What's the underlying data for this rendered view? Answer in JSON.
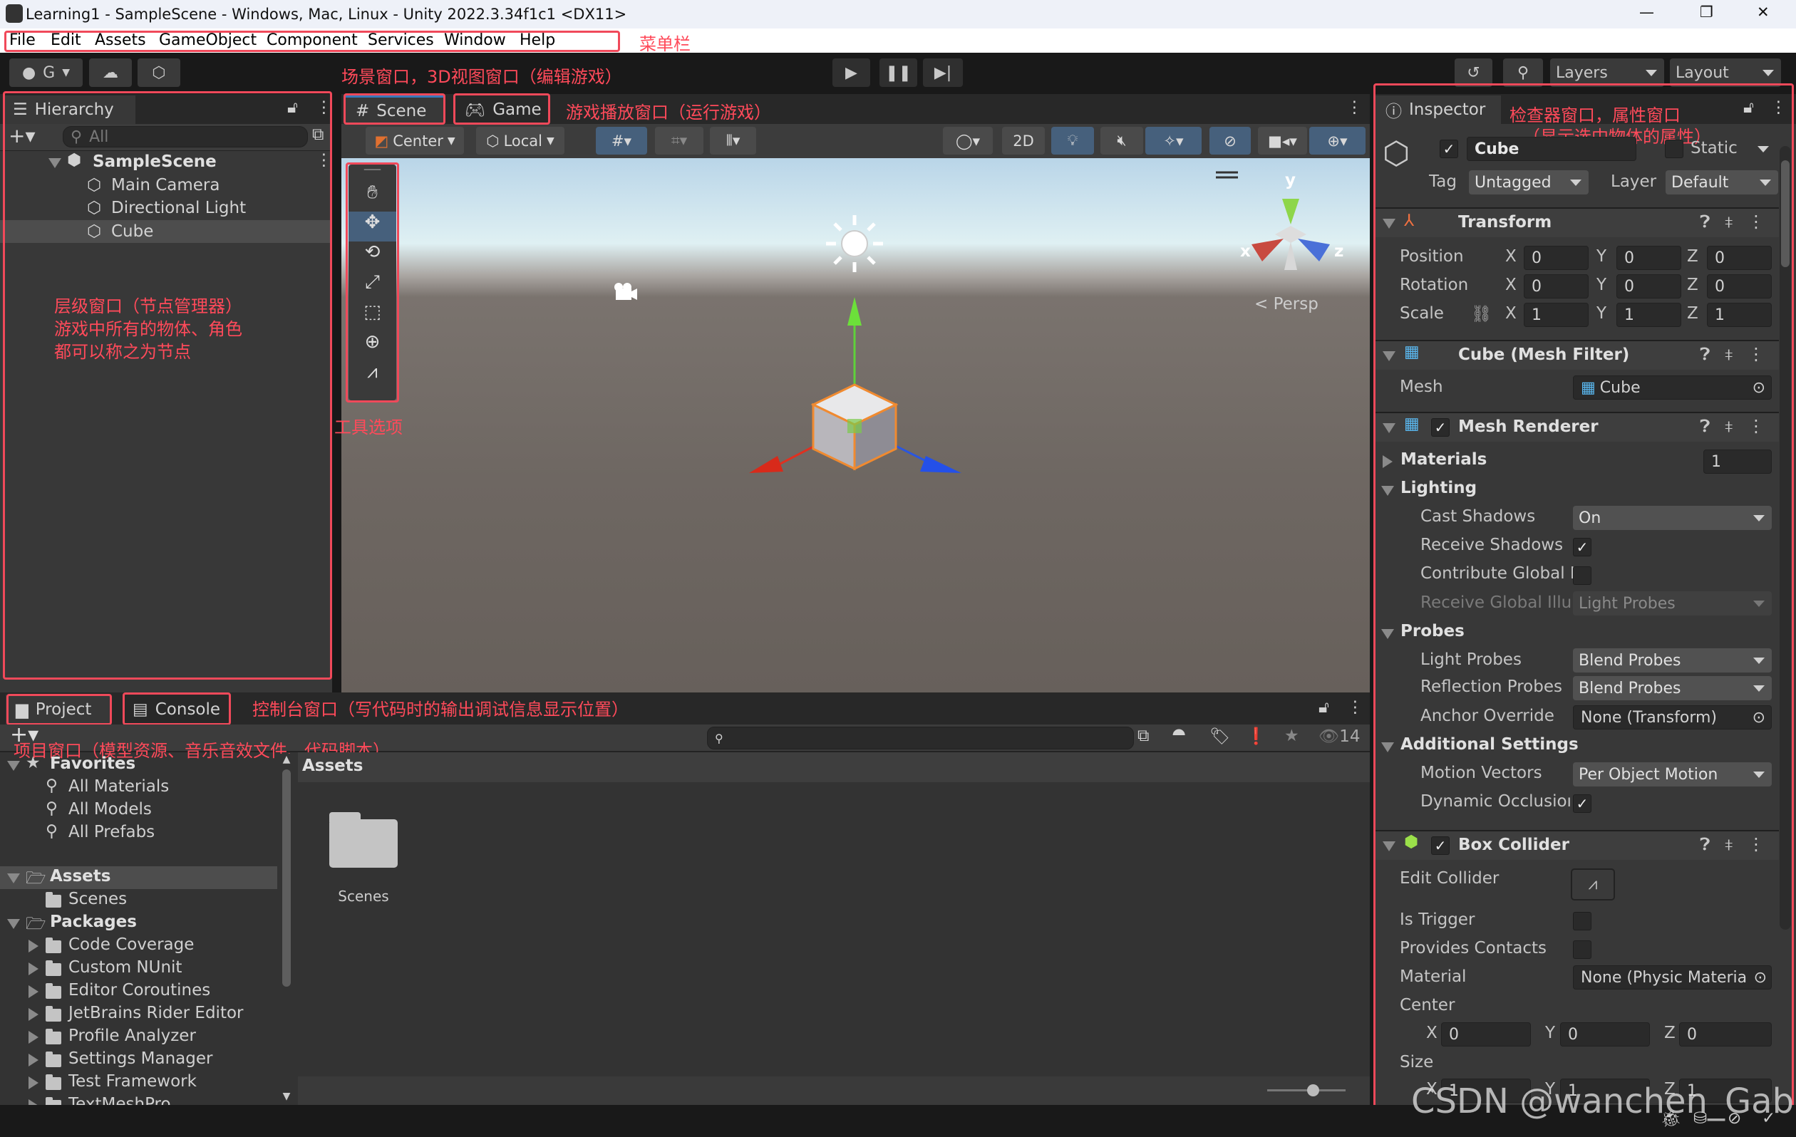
{
  "window": {
    "title": "Learning1 - SampleScene - Windows, Mac, Linux - Unity 2022.3.34f1c1 <DX11>",
    "controls": [
      "—",
      "❐",
      "✕"
    ]
  },
  "menu": {
    "items": [
      "File",
      "Edit",
      "Assets",
      "GameObject",
      "Component",
      "Services",
      "Window",
      "Help"
    ]
  },
  "toolbar": {
    "account": "G",
    "layers": "Layers",
    "layout": "Layout"
  },
  "annotations": {
    "menubar": "菜单栏",
    "scene": "场景窗口，3D视图窗口（编辑游戏）",
    "game": "游戏播放窗口（运行游戏）",
    "hierarchy": [
      "层级窗口（节点管理器）",
      "游戏中所有的物体、角色",
      "都可以称之为节点"
    ],
    "tools": "工具选项",
    "inspector": [
      "检查器窗口，属性窗口",
      "（显示选中物体的属性）"
    ],
    "console": "控制台窗口（写代码时的输出调试信息显示位置）",
    "project": "项目窗口（模型资源、音乐音效文件、代码脚本）"
  },
  "hierarchy": {
    "tab": "Hierarchy",
    "search_placeholder": "All",
    "scene": "SampleScene",
    "items": [
      "Main Camera",
      "Directional Light",
      "Cube"
    ],
    "selected": "Cube"
  },
  "scene": {
    "tabs": [
      "Scene",
      "Game"
    ],
    "active_tab": "Scene",
    "pivot": "Center",
    "space": "Local",
    "mode_2d": "2D",
    "projection": "Persp",
    "gizmo_axes": [
      "x",
      "y",
      "z"
    ]
  },
  "inspector": {
    "tab": "Inspector",
    "object": {
      "active": true,
      "name": "Cube",
      "static_label": "Static",
      "static": false,
      "tag_label": "Tag",
      "tag": "Untagged",
      "layer_label": "Layer",
      "layer": "Default"
    },
    "transform": {
      "title": "Transform",
      "rows": [
        {
          "label": "Position",
          "x": "0",
          "y": "0",
          "z": "0"
        },
        {
          "label": "Rotation",
          "x": "0",
          "y": "0",
          "z": "0"
        },
        {
          "label": "Scale",
          "x": "1",
          "y": "1",
          "z": "1"
        }
      ],
      "axes": [
        "X",
        "Y",
        "Z"
      ]
    },
    "mesh_filter": {
      "title": "Cube (Mesh Filter)",
      "mesh_label": "Mesh",
      "mesh": "Cube"
    },
    "mesh_renderer": {
      "title": "Mesh Renderer",
      "enabled": true,
      "materials_label": "Materials",
      "materials_count": "1",
      "lighting_label": "Lighting",
      "cast_shadows_label": "Cast Shadows",
      "cast_shadows": "On",
      "receive_shadows_label": "Receive Shadows",
      "receive_shadows": true,
      "contribute_gi_label": "Contribute Global I",
      "contribute_gi": false,
      "receive_gi_label": "Receive Global Illu",
      "receive_gi": "Light Probes",
      "probes_label": "Probes",
      "light_probes_label": "Light Probes",
      "light_probes": "Blend Probes",
      "reflection_probes_label": "Reflection Probes",
      "reflection_probes": "Blend Probes",
      "anchor_override_label": "Anchor Override",
      "anchor_override": "None (Transform)",
      "additional_label": "Additional Settings",
      "motion_vectors_label": "Motion Vectors",
      "motion_vectors": "Per Object Motion",
      "dynamic_occlusion_label": "Dynamic Occlusioı",
      "dynamic_occlusion": true
    },
    "box_collider": {
      "title": "Box Collider",
      "enabled": true,
      "edit_collider_label": "Edit Collider",
      "is_trigger_label": "Is Trigger",
      "is_trigger": false,
      "provides_contacts_label": "Provides Contacts",
      "provides_contacts": false,
      "material_label": "Material",
      "material": "None (Physic Materia",
      "center_label": "Center",
      "center": {
        "x": "0",
        "y": "0",
        "z": "0"
      },
      "size_label": "Size",
      "size": {
        "x": "1",
        "y": "1",
        "z": "1"
      }
    }
  },
  "project": {
    "tabs": [
      "Project",
      "Console"
    ],
    "hidden_count": "14",
    "tree": [
      {
        "label": "Favorites",
        "kind": "header",
        "icon": "star"
      },
      {
        "label": "All Materials",
        "kind": "search"
      },
      {
        "label": "All Models",
        "kind": "search"
      },
      {
        "label": "All Prefabs",
        "kind": "search"
      },
      {
        "label": "Assets",
        "kind": "header",
        "icon": "folder-open",
        "selected": true
      },
      {
        "label": "Scenes",
        "kind": "folder"
      },
      {
        "label": "Packages",
        "kind": "header",
        "icon": "folder-open"
      },
      {
        "label": "Code Coverage",
        "kind": "package"
      },
      {
        "label": "Custom NUnit",
        "kind": "package"
      },
      {
        "label": "Editor Coroutines",
        "kind": "package"
      },
      {
        "label": "JetBrains Rider Editor",
        "kind": "package"
      },
      {
        "label": "Profile Analyzer",
        "kind": "package"
      },
      {
        "label": "Settings Manager",
        "kind": "package"
      },
      {
        "label": "Test Framework",
        "kind": "package"
      },
      {
        "label": "TextMeshPro",
        "kind": "package"
      }
    ],
    "breadcrumb": "Assets",
    "assets": [
      {
        "name": "Scenes",
        "type": "folder"
      }
    ]
  },
  "watermark": "CSDN @wanchen_Gabby",
  "colors": {
    "annotation": "#ff4a5a",
    "accent_blue": "#46607c",
    "panel": "#383838"
  }
}
